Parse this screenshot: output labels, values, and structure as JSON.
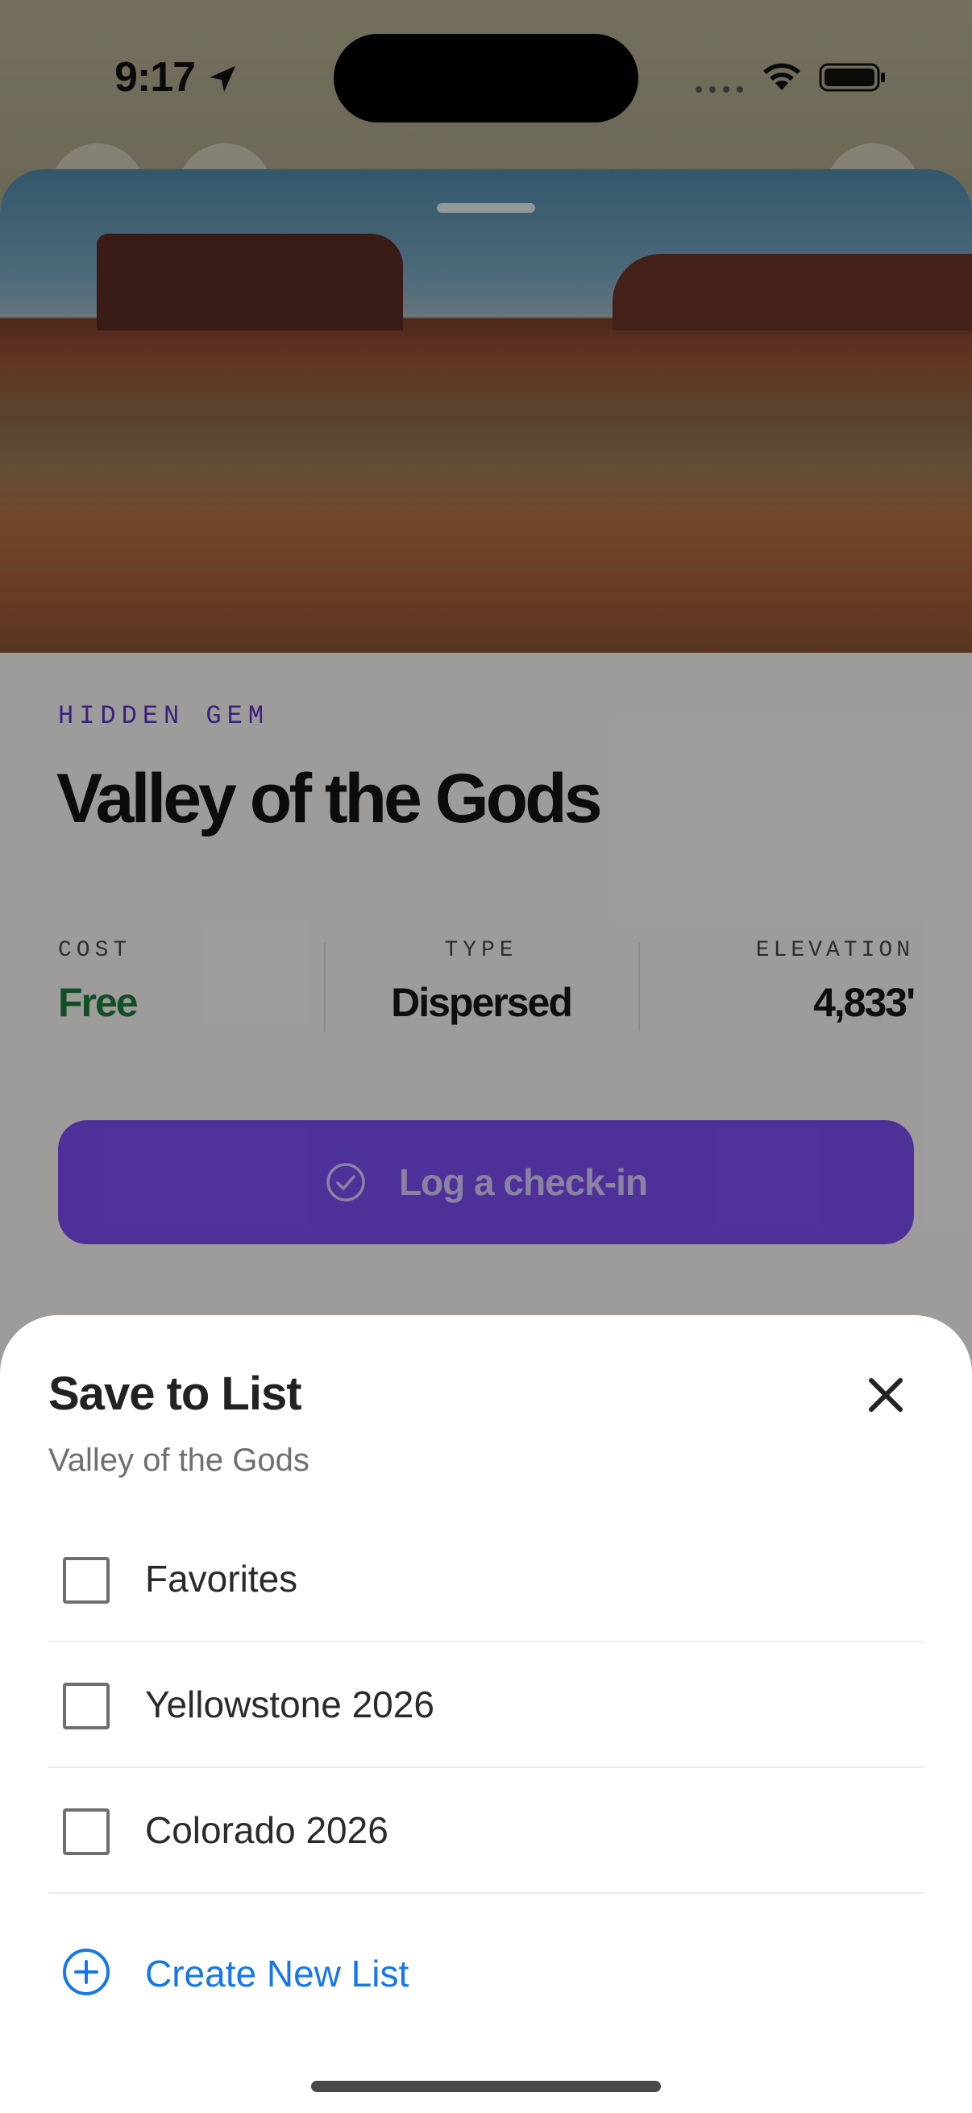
{
  "status_bar": {
    "time": "9:17"
  },
  "place": {
    "category": "HIDDEN GEM",
    "name": "Valley of the Gods",
    "stats": [
      {
        "label": "COST",
        "value": "Free",
        "color": "#1f7a3e"
      },
      {
        "label": "TYPE",
        "value": "Dispersed",
        "color": "#171717"
      },
      {
        "label": "ELEVATION",
        "value": "4,833'",
        "color": "#171717"
      }
    ],
    "checkin_label": "Log a check-in"
  },
  "sheet": {
    "title": "Save to List",
    "subtitle": "Valley of the Gods",
    "lists": [
      {
        "label": "Favorites",
        "checked": false
      },
      {
        "label": "Yellowstone 2026",
        "checked": false
      },
      {
        "label": "Colorado 2026",
        "checked": false
      }
    ],
    "create_label": "Create New List",
    "accent_color": "#1677e6"
  }
}
